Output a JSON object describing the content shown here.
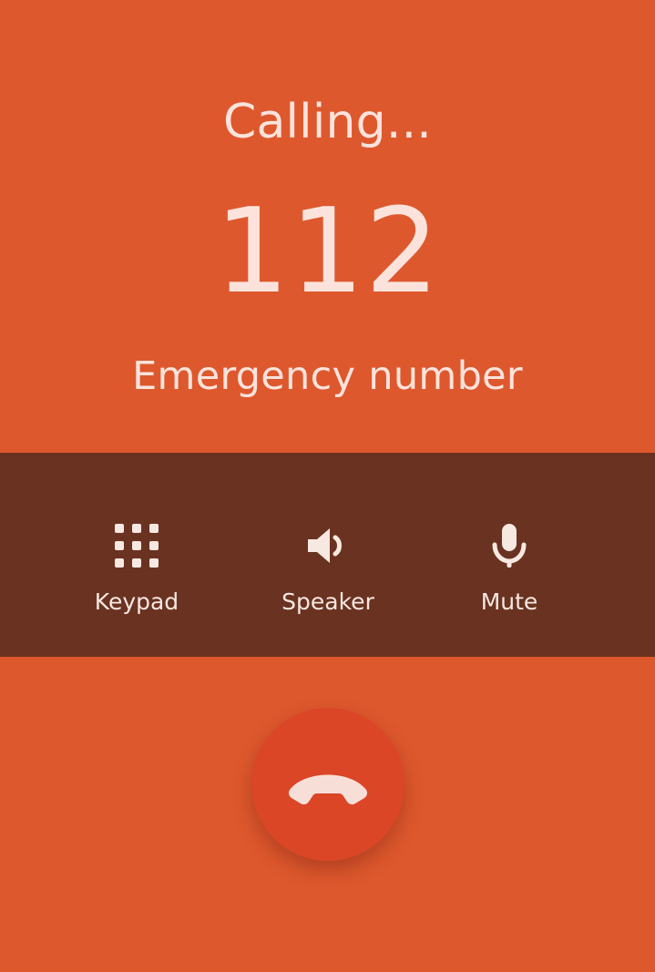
{
  "call": {
    "status": "Calling...",
    "number": "112",
    "label": "Emergency number"
  },
  "controls": [
    {
      "label": "Keypad",
      "icon": "keypad-icon"
    },
    {
      "label": "Speaker",
      "icon": "speaker-icon"
    },
    {
      "label": "Mute",
      "icon": "microphone-icon"
    }
  ],
  "end_call": {
    "icon": "end-call-phone-icon"
  },
  "colors": {
    "background": "#de582d",
    "controls_bar": "#6a3220",
    "end_call_button": "#db4626",
    "text": "#fbe3dc"
  }
}
